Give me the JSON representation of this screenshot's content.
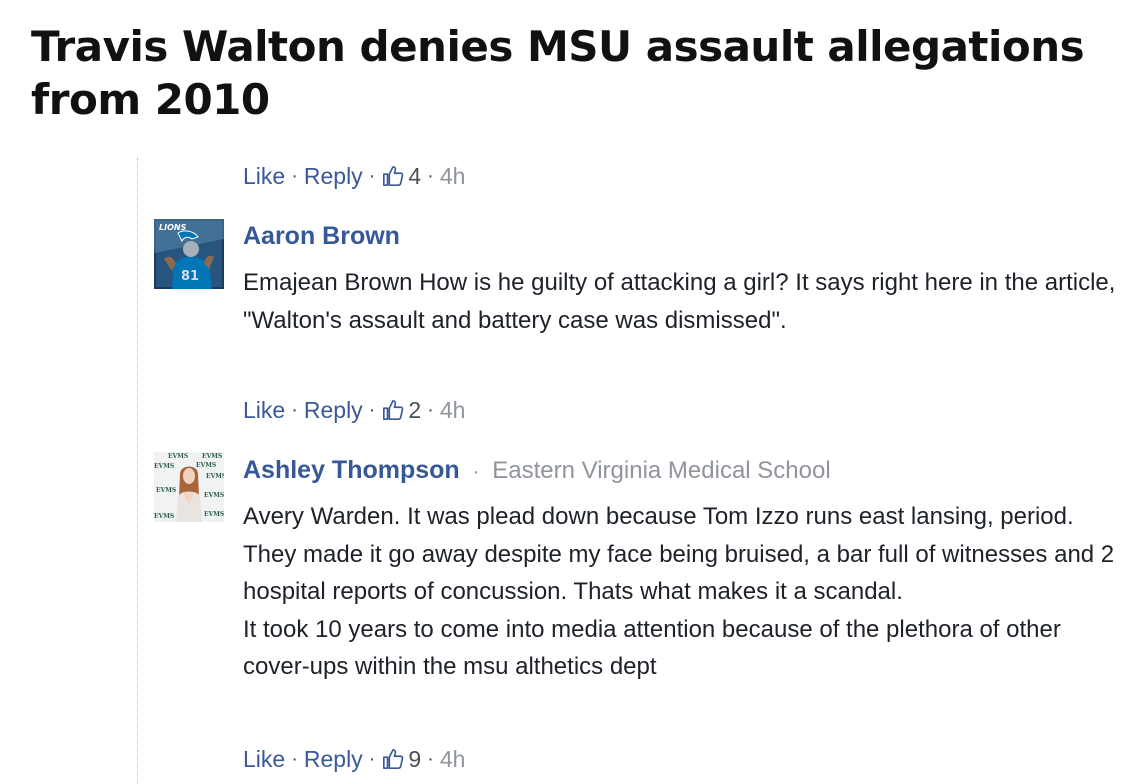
{
  "article": {
    "headline": "Travis Walton denies MSU assault allegations from 2010"
  },
  "comments": [
    {
      "actions": {
        "like": "Like",
        "reply": "Reply",
        "separator": "·",
        "likes": "4",
        "time": "4h"
      }
    },
    {
      "author": "Aaron Brown",
      "affiliation": "",
      "paragraphs": [
        "Emajean Brown How is he guilty of attacking a girl? It says right here in the article, \"Walton's assault and battery case was dismissed\"."
      ],
      "actions": {
        "like": "Like",
        "reply": "Reply",
        "separator": "·",
        "likes": "2",
        "time": "4h"
      }
    },
    {
      "author": "Ashley Thompson",
      "author_separator": "·",
      "affiliation": "Eastern Virginia Medical School",
      "paragraphs": [
        "Avery Warden. It was plead down because Tom Izzo runs east lansing, period. They made it go away despite my face being bruised, a bar full of witnesses and 2 hospital reports of concussion. Thats what makes it a scandal.",
        "It took 10 years to come into media attention because of the plethora of other cover-ups within the msu althetics dept"
      ],
      "actions": {
        "like": "Like",
        "reply": "Reply",
        "separator": "·",
        "likes": "9",
        "time": "4h"
      }
    }
  ],
  "avatars": {
    "aaron": {
      "badge_text": "LIONS",
      "jersey_number": "81",
      "colors": [
        "#1b3a5c",
        "#0076b6",
        "#b0b7bc"
      ]
    },
    "ashley": {
      "backdrop_text": "EVMS",
      "colors": [
        "#f1f2f4",
        "#2f5f4a",
        "#a8653a"
      ]
    }
  },
  "theme": {
    "link_color": "#3b5998",
    "author_color": "#365899",
    "meta_color": "#90949c"
  }
}
